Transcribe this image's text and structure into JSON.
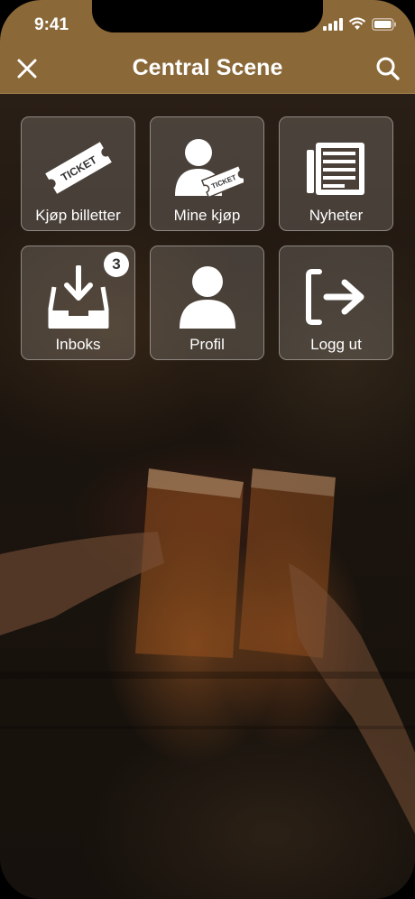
{
  "status_bar": {
    "time": "9:41"
  },
  "header": {
    "title": "Central Scene"
  },
  "menu": [
    {
      "label": "Kjøp billetter",
      "icon": "ticket-icon"
    },
    {
      "label": "Mine kjøp",
      "icon": "user-ticket-icon"
    },
    {
      "label": "Nyheter",
      "icon": "newspaper-icon"
    },
    {
      "label": "Inboks",
      "icon": "inbox-download-icon",
      "badge": "3"
    },
    {
      "label": "Profil",
      "icon": "user-icon"
    },
    {
      "label": "Logg ut",
      "icon": "logout-icon"
    }
  ],
  "ticket_text": "TICKET",
  "colors": {
    "header": "#8a6838",
    "tile_border": "rgba(255,255,255,0.38)"
  }
}
